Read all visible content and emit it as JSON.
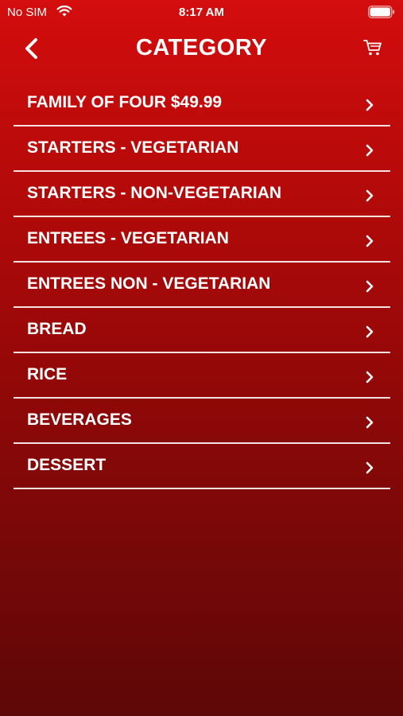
{
  "status_bar": {
    "carrier": "No SIM",
    "time": "8:17 AM"
  },
  "nav": {
    "title": "CATEGORY"
  },
  "categories": [
    {
      "label": "FAMILY OF FOUR $49.99"
    },
    {
      "label": "STARTERS - VEGETARIAN"
    },
    {
      "label": "STARTERS - NON-VEGETARIAN"
    },
    {
      "label": "ENTREES - VEGETARIAN"
    },
    {
      "label": "ENTREES NON - VEGETARIAN"
    },
    {
      "label": "BREAD"
    },
    {
      "label": "RICE"
    },
    {
      "label": "BEVERAGES"
    },
    {
      "label": "DESSERT"
    }
  ],
  "icons": {
    "back": "chevron-left-icon",
    "cart": "cart-icon",
    "row": "chevron-right-icon",
    "wifi": "wifi-icon",
    "battery": "battery-icon"
  }
}
